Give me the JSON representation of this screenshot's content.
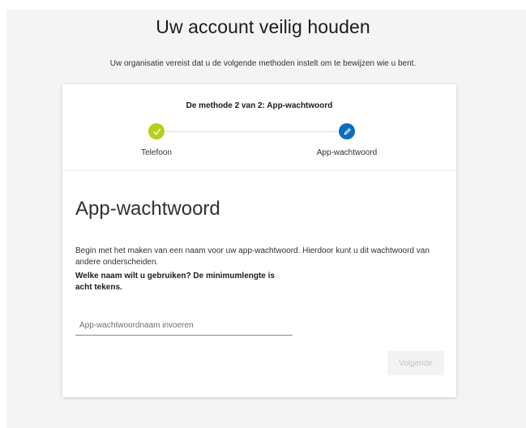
{
  "header": {
    "title": "Uw account veilig houden",
    "subtitle": "Uw organisatie vereist dat u de volgende methoden instelt om te bewijzen wie u bent."
  },
  "wizard": {
    "step_caption": "De methode 2 van 2: App-wachtwoord",
    "steps": [
      {
        "label": "Telefoon",
        "state": "completed",
        "icon": "checkmark-icon",
        "color": "#b5cd1b"
      },
      {
        "label": "App-wachtwoord",
        "state": "active",
        "icon": "pencil-icon",
        "color": "#0f6cbd"
      }
    ]
  },
  "form": {
    "heading": "App-wachtwoord",
    "description": "Begin met het maken van een naam voor uw app-wachtwoord. Hierdoor kunt u dit wachtwoord van andere onderscheiden.",
    "question": "Welke naam wilt u gebruiken? De minimumlengte is acht tekens.",
    "name_input": {
      "value": "",
      "placeholder": "App-wachtwoordnaam invoeren"
    },
    "next_label": "Volgende",
    "next_enabled": false
  }
}
